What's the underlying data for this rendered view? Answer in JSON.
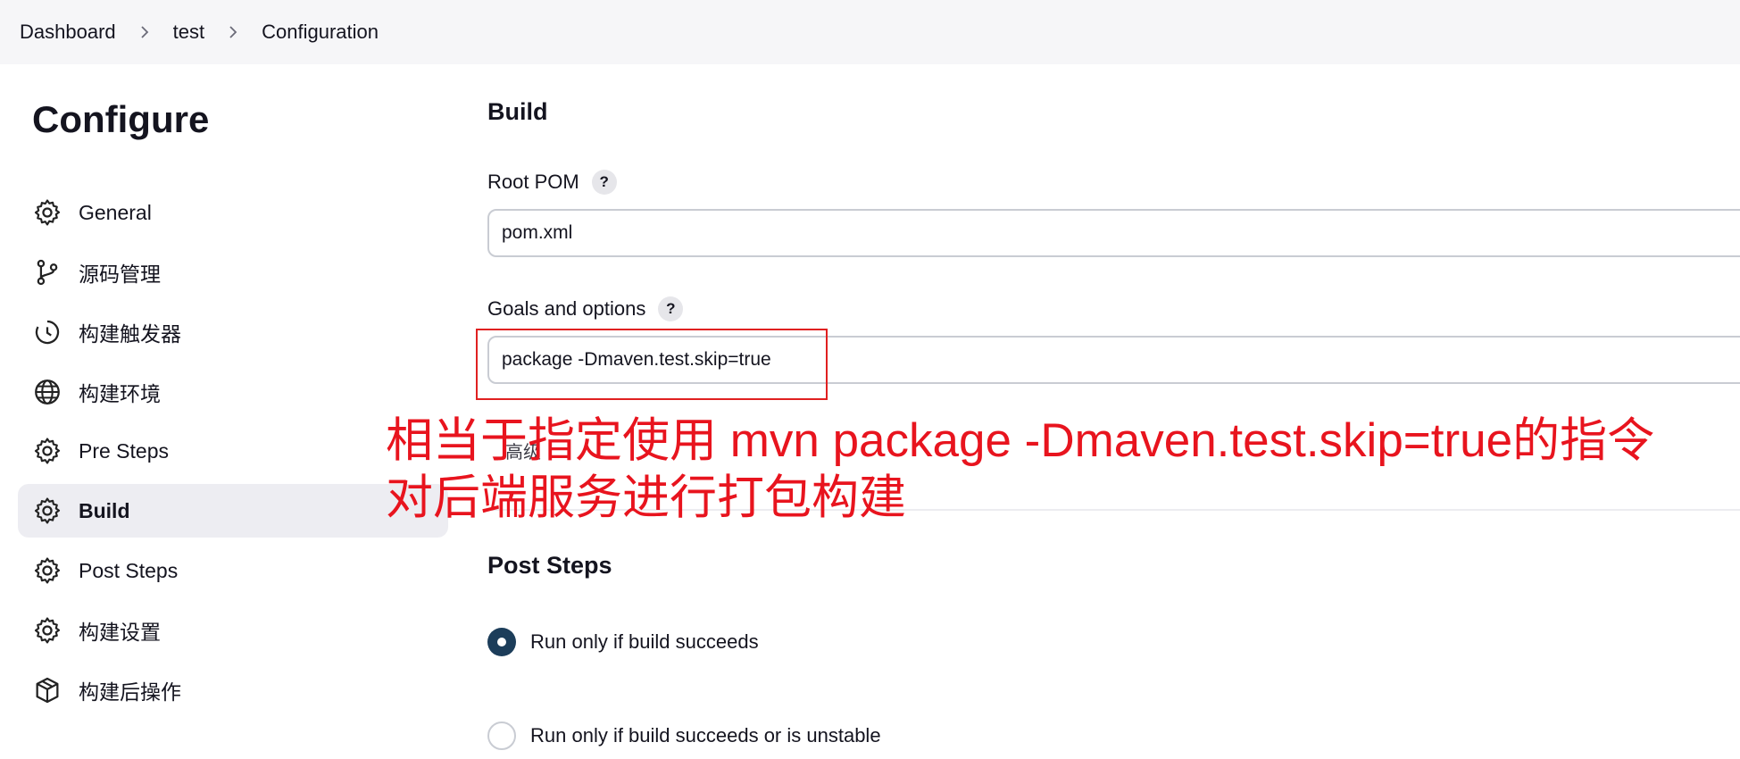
{
  "breadcrumb": {
    "items": [
      "Dashboard",
      "test",
      "Configuration"
    ]
  },
  "sidebar": {
    "title": "Configure",
    "items": [
      {
        "label": "General",
        "icon": "gear-icon"
      },
      {
        "label": "源码管理",
        "icon": "git-branch-icon"
      },
      {
        "label": "构建触发器",
        "icon": "clock-icon"
      },
      {
        "label": "构建环境",
        "icon": "globe-icon"
      },
      {
        "label": "Pre Steps",
        "icon": "gear-icon"
      },
      {
        "label": "Build",
        "icon": "gear-icon",
        "active": true
      },
      {
        "label": "Post Steps",
        "icon": "gear-icon"
      },
      {
        "label": "构建设置",
        "icon": "gear-icon"
      },
      {
        "label": "构建后操作",
        "icon": "package-icon"
      }
    ]
  },
  "build": {
    "title": "Build",
    "root_pom": {
      "label": "Root POM",
      "help": "?",
      "value": "pom.xml"
    },
    "goals": {
      "label": "Goals and options",
      "help": "?",
      "value": "package -Dmaven.test.skip=true"
    },
    "advanced_label": "高级"
  },
  "annotation": {
    "line1": "相当于指定使用 mvn package -Dmaven.test.skip=true的指令",
    "line2": "对后端服务进行打包构建",
    "color": "#e8141e"
  },
  "post_steps": {
    "title": "Post Steps",
    "options": [
      {
        "label": "Run only if build succeeds",
        "selected": true
      },
      {
        "label": "Run only if build succeeds or is unstable",
        "selected": false
      }
    ]
  },
  "colors": {
    "accent": "#1c3d5a",
    "annotation_red": "#e8141e",
    "sidebar_active_bg": "#ededf2",
    "breadcrumb_bg": "#f6f6f8"
  }
}
